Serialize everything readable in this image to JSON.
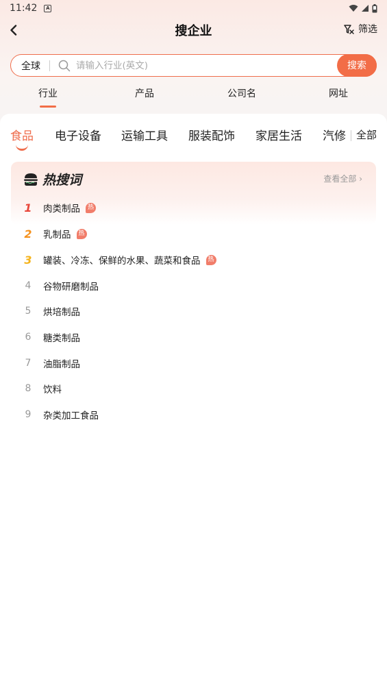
{
  "status_bar": {
    "time": "11:42",
    "notification_icon": "a-icon",
    "wifi_icon": "wifi-icon",
    "signal_icon": "signal-icon",
    "battery_icon": "battery-icon"
  },
  "header": {
    "title": "搜企业",
    "back_icon": "chevron-left-icon",
    "filter_label": "筛选",
    "filter_icon": "filter-icon"
  },
  "search": {
    "scope": "全球",
    "placeholder": "请输入行业(英文)",
    "value": "",
    "button_label": "搜索",
    "accent_color": "#f26d47"
  },
  "mode_tabs": [
    {
      "label": "行业",
      "active": true
    },
    {
      "label": "产品",
      "active": false
    },
    {
      "label": "公司名",
      "active": false
    },
    {
      "label": "网址",
      "active": false
    }
  ],
  "category_tabs": {
    "items": [
      {
        "label": "食品",
        "active": true
      },
      {
        "label": "电子设备",
        "active": false
      },
      {
        "label": "运输工具",
        "active": false
      },
      {
        "label": "服装配饰",
        "active": false
      },
      {
        "label": "家居生活",
        "active": false
      },
      {
        "label": "汽修",
        "active": false
      }
    ],
    "all_label": "全部"
  },
  "hot_card": {
    "title": "热搜词",
    "view_all": "查看全部 ›",
    "items": [
      {
        "rank": "1",
        "label": "肉类制品",
        "badge": "热"
      },
      {
        "rank": "2",
        "label": "乳制品",
        "badge": "热"
      },
      {
        "rank": "3",
        "label": "罐装、冷冻、保鲜的水果、蔬菜和食品",
        "badge": "热"
      },
      {
        "rank": "4",
        "label": "谷物研磨制品"
      },
      {
        "rank": "5",
        "label": "烘培制品"
      },
      {
        "rank": "6",
        "label": "糖类制品"
      },
      {
        "rank": "7",
        "label": "油脂制品"
      },
      {
        "rank": "8",
        "label": "饮料"
      },
      {
        "rank": "9",
        "label": "杂类加工食品"
      }
    ]
  }
}
